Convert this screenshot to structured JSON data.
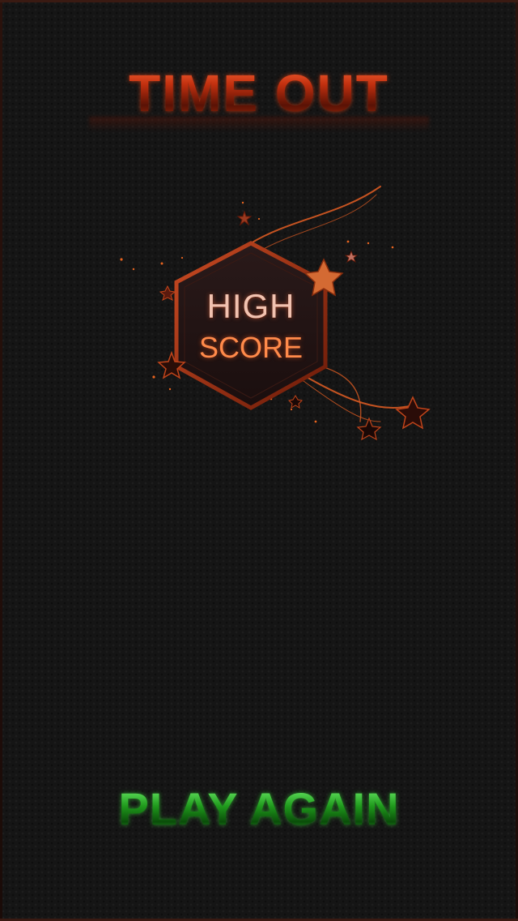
{
  "screen": {
    "title": "TIME OUT",
    "high_score_badge": {
      "line1": "HIGH",
      "line2": "SCORE"
    },
    "play_again_label": "PLAY AGAIN"
  },
  "colors": {
    "title": "#c2300f",
    "badge_accent": "#ff8a4a",
    "play_again": "#1f9a1c",
    "background": "#151515"
  }
}
